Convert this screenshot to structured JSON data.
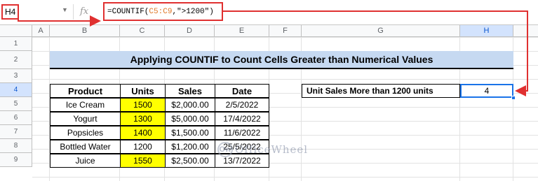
{
  "formula_bar": {
    "name_box": "H4",
    "fx_label": "fx",
    "formula_prefix": "=COUNTIF(",
    "formula_range": "C5:C9",
    "formula_suffix": ",\">1200\")"
  },
  "columns": [
    "A",
    "B",
    "C",
    "D",
    "E",
    "F",
    "G",
    "H"
  ],
  "rows": [
    "1",
    "2",
    "3",
    "4",
    "5",
    "6",
    "7",
    "8",
    "9"
  ],
  "title": "Applying COUNTIF to Count Cells Greater than Numerical Values",
  "table": {
    "headers": [
      "Product",
      "Units",
      "Sales",
      "Date"
    ],
    "rows": [
      {
        "product": "Ice Cream",
        "units": "1500",
        "sales": "$2,000.00",
        "date": "2/5/2022",
        "highlight": true
      },
      {
        "product": "Yogurt",
        "units": "1300",
        "sales": "$5,000.00",
        "date": "17/4/2022",
        "highlight": true
      },
      {
        "product": "Popsicles",
        "units": "1400",
        "sales": "$1,500.00",
        "date": "11/6/2022",
        "highlight": true
      },
      {
        "product": "Bottled Water",
        "units": "1200",
        "sales": "$1,200.00",
        "date": "25/5/2022",
        "highlight": false
      },
      {
        "product": "Juice",
        "units": "1550",
        "sales": "$2,500.00",
        "date": "13/7/2022",
        "highlight": true
      }
    ]
  },
  "summary": {
    "label": "Unit Sales More than 1200 units",
    "value": "4"
  },
  "watermark": "OfficeWheel",
  "colors": {
    "annotation_red": "#e03030",
    "title_band": "#c6d9f1",
    "highlight_yellow": "#ffff00",
    "selection_blue": "#1a73e8",
    "range_ref_orange": "#e07a2a"
  }
}
